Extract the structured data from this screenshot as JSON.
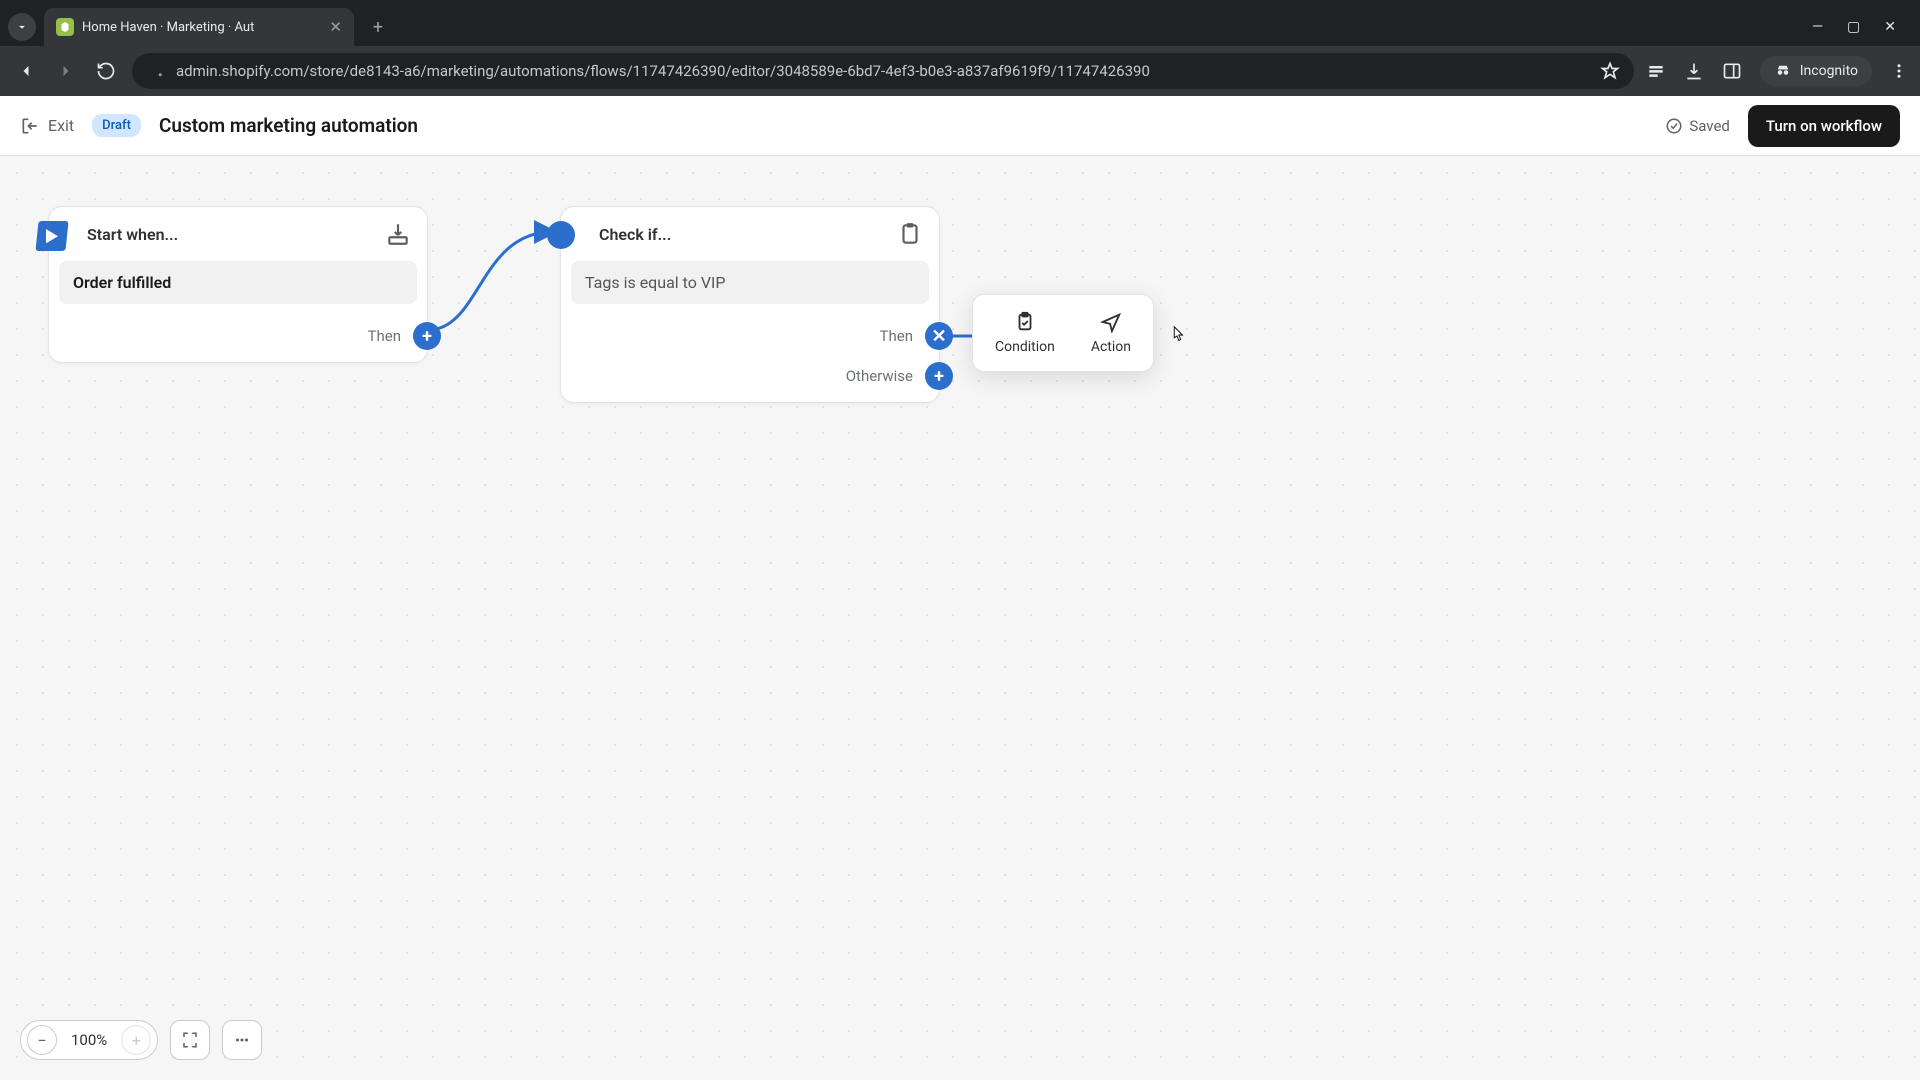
{
  "browser": {
    "tab_title": "Home Haven · Marketing · Aut",
    "url": "admin.shopify.com/store/de8143-a6/marketing/automations/flows/11747426390/editor/3048589e-6bd7-4ef3-b0e3-a837af9619f9/11747426390",
    "incognito_label": "Incognito"
  },
  "header": {
    "exit_label": "Exit",
    "badge": "Draft",
    "title": "Custom marketing automation",
    "saved_label": "Saved",
    "primary_button": "Turn on workflow"
  },
  "canvas": {
    "trigger": {
      "title": "Start when...",
      "event": "Order fulfilled",
      "branch_label": "Then"
    },
    "condition": {
      "title": "Check if...",
      "rule": "Tags is equal to VIP",
      "then_label": "Then",
      "otherwise_label": "Otherwise"
    },
    "popover": {
      "condition_label": "Condition",
      "action_label": "Action"
    },
    "zoom": "100%"
  }
}
